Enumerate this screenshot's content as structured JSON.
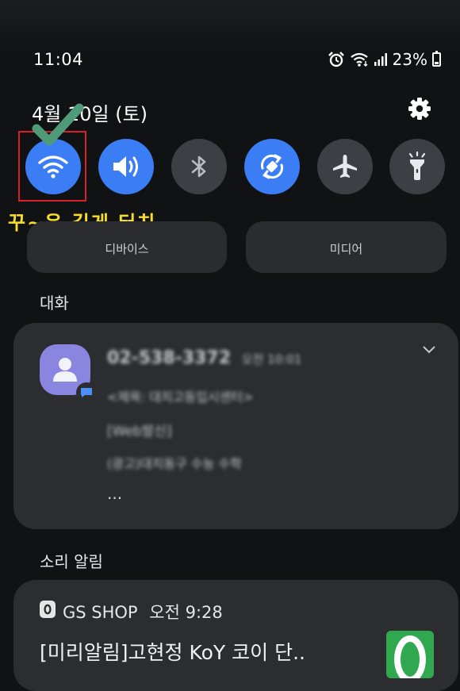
{
  "status_bar": {
    "time": "11:04",
    "battery": "23%"
  },
  "header": {
    "date": "4월 10일 (토)"
  },
  "quick_settings": [
    {
      "name": "wifi",
      "state": "on",
      "icon": "wifi-icon"
    },
    {
      "name": "sound",
      "state": "on",
      "icon": "volume-icon"
    },
    {
      "name": "bluetooth",
      "state": "off",
      "icon": "bluetooth-icon"
    },
    {
      "name": "auto-rotate",
      "state": "on",
      "icon": "rotate-icon"
    },
    {
      "name": "airplane",
      "state": "off",
      "icon": "airplane-icon"
    },
    {
      "name": "flashlight",
      "state": "off",
      "icon": "flashlight-icon"
    }
  ],
  "annotation": {
    "caption": "꾸~욱 길게 터치",
    "box_color": "#d8202a",
    "check_color": "#4f9a79",
    "caption_color": "#f7df2b"
  },
  "media_buttons": {
    "devices": "디바이스",
    "media": "미디어"
  },
  "conversations": {
    "title": "대화",
    "message": {
      "sender": "02-538-3372",
      "time": "오전 10:01",
      "lines": [
        "<제목: 대치고등입시센터>",
        "[Web발신]",
        "(광고)대치동구 수능 수학"
      ],
      "more": "..."
    }
  },
  "sound_alerts": {
    "title": "소리 알림",
    "notification": {
      "app": "GS SHOP",
      "time": "오전 9:28",
      "text": "[미리알림]고현정 KoY 코이 단.."
    }
  },
  "colors": {
    "accent": "#3b7df5",
    "tile_off": "#3d3f44",
    "card": "#2c2d31",
    "background": "#111214"
  }
}
